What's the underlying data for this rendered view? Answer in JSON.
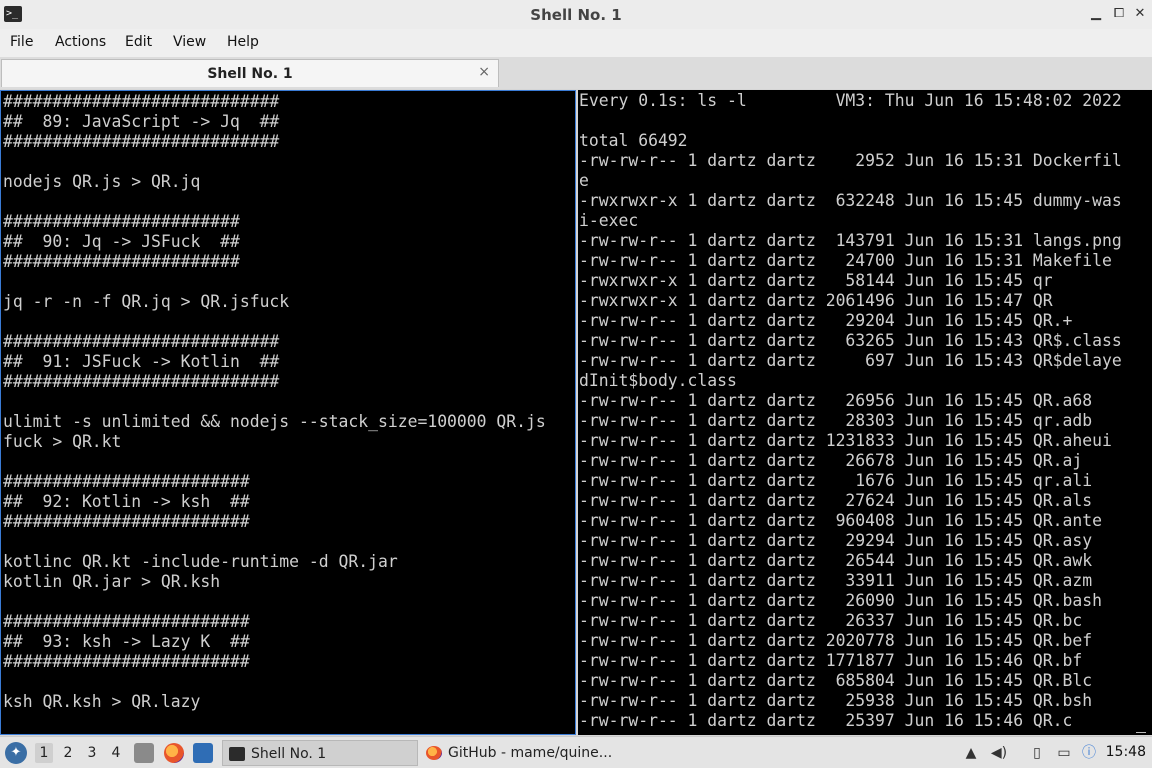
{
  "window": {
    "title": "Shell No. 1",
    "app_icon_glyph": ">_",
    "minimize_glyph": "▁",
    "restore_glyph": "⧠",
    "close_glyph": "✕"
  },
  "menu": [
    "File",
    "Actions",
    "Edit",
    "View",
    "Help"
  ],
  "tab": {
    "label": "Shell No. 1",
    "close_glyph": "×"
  },
  "left_terminal": [
    "############################",
    "##  89: JavaScript -> Jq  ##",
    "############################",
    "",
    "nodejs QR.js > QR.jq",
    "",
    "########################",
    "##  90: Jq -> JSFuck  ##",
    "########################",
    "",
    "jq -r -n -f QR.jq > QR.jsfuck",
    "",
    "############################",
    "##  91: JSFuck -> Kotlin  ##",
    "############################",
    "",
    "ulimit -s unlimited && nodejs --stack_size=100000 QR.js",
    "fuck > QR.kt",
    "",
    "#########################",
    "##  92: Kotlin -> ksh  ##",
    "#########################",
    "",
    "kotlinc QR.kt -include-runtime -d QR.jar",
    "kotlin QR.jar > QR.ksh",
    "",
    "#########################",
    "##  93: ksh -> Lazy K  ##",
    "#########################",
    "",
    "ksh QR.ksh > QR.lazy",
    ""
  ],
  "right_terminal": [
    "Every 0.1s: ls -l         VM3: Thu Jun 16 15:48:02 2022",
    "",
    "total 66492",
    "-rw-rw-r-- 1 dartz dartz    2952 Jun 16 15:31 Dockerfil",
    "e",
    "-rwxrwxr-x 1 dartz dartz  632248 Jun 16 15:45 dummy-was",
    "i-exec",
    "-rw-rw-r-- 1 dartz dartz  143791 Jun 16 15:31 langs.png",
    "-rw-rw-r-- 1 dartz dartz   24700 Jun 16 15:31 Makefile",
    "-rwxrwxr-x 1 dartz dartz   58144 Jun 16 15:45 qr",
    "-rwxrwxr-x 1 dartz dartz 2061496 Jun 16 15:47 QR",
    "-rw-rw-r-- 1 dartz dartz   29204 Jun 16 15:45 QR.+",
    "-rw-rw-r-- 1 dartz dartz   63265 Jun 16 15:43 QR$.class",
    "-rw-rw-r-- 1 dartz dartz     697 Jun 16 15:43 QR$delaye",
    "dInit$body.class",
    "-rw-rw-r-- 1 dartz dartz   26956 Jun 16 15:45 QR.a68",
    "-rw-rw-r-- 1 dartz dartz   28303 Jun 16 15:45 qr.adb",
    "-rw-rw-r-- 1 dartz dartz 1231833 Jun 16 15:45 QR.aheui",
    "-rw-rw-r-- 1 dartz dartz   26678 Jun 16 15:45 QR.aj",
    "-rw-rw-r-- 1 dartz dartz    1676 Jun 16 15:45 qr.ali",
    "-rw-rw-r-- 1 dartz dartz   27624 Jun 16 15:45 QR.als",
    "-rw-rw-r-- 1 dartz dartz  960408 Jun 16 15:45 QR.ante",
    "-rw-rw-r-- 1 dartz dartz   29294 Jun 16 15:45 QR.asy",
    "-rw-rw-r-- 1 dartz dartz   26544 Jun 16 15:45 QR.awk",
    "-rw-rw-r-- 1 dartz dartz   33911 Jun 16 15:45 QR.azm",
    "-rw-rw-r-- 1 dartz dartz   26090 Jun 16 15:45 QR.bash",
    "-rw-rw-r-- 1 dartz dartz   26337 Jun 16 15:45 QR.bc",
    "-rw-rw-r-- 1 dartz dartz 2020778 Jun 16 15:45 QR.bef",
    "-rw-rw-r-- 1 dartz dartz 1771877 Jun 16 15:46 QR.bf",
    "-rw-rw-r-- 1 dartz dartz  685804 Jun 16 15:45 QR.Blc",
    "-rw-rw-r-- 1 dartz dartz   25938 Jun 16 15:45 QR.bsh",
    "-rw-rw-r-- 1 dartz dartz   25397 Jun 16 15:46 QR.c"
  ],
  "taskbar": {
    "start_icon": "lxqt-logo-icon",
    "workspaces": [
      "1",
      "2",
      "3",
      "4"
    ],
    "active_workspace": "1",
    "quicklaunch": [
      "file-manager-icon",
      "firefox-icon",
      "show-desktop-icon"
    ],
    "tasks": [
      {
        "label": "Shell No. 1",
        "icon": "terminal-icon",
        "active": true
      },
      {
        "label": "GitHub - mame/quine...",
        "icon": "firefox-icon",
        "active": false
      }
    ],
    "tray": [
      "battery-icon",
      "volume-icon",
      "clipboard-icon",
      "network-icon",
      "info-icon"
    ],
    "clock": "15:48"
  },
  "colors": {
    "terminal_bg": "#000000",
    "terminal_fg": "#cfcfcf",
    "focus_border": "#3a7bd5",
    "chrome_bg": "#ececec"
  }
}
